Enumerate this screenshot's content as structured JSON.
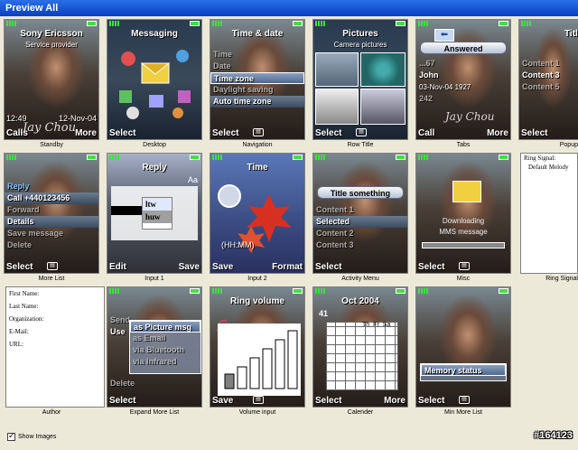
{
  "window": {
    "title": "Preview All"
  },
  "cells": {
    "standby": {
      "label": "Standby",
      "title": "Sony Ericsson",
      "subtitle": "Service provider",
      "time": "12:49",
      "date": "12-Nov-04",
      "artist": "Jay Chou",
      "left": "Calls",
      "right": "More"
    },
    "desktop": {
      "label": "Desktop",
      "title": "Messaging",
      "left": "Select"
    },
    "navigation": {
      "label": "Navigation",
      "title": "Time & date",
      "items": [
        "Time",
        "Date",
        "Time zone",
        "Daylight saving",
        "Auto time zone"
      ],
      "left": "Select"
    },
    "rowtitle": {
      "label": "Row Title",
      "title": "Pictures",
      "subtitle": "Camera pictures",
      "left": "Select"
    },
    "tabs": {
      "label": "Tabs",
      "tab": "Answered",
      "rows": [
        "...67",
        "John",
        "03-Nov-04 1927",
        "242"
      ],
      "artist": "Jay Chou",
      "left": "Call",
      "right": "More"
    },
    "popup": {
      "label": "Popup",
      "title": "Title",
      "items": [
        "Content 1",
        "Content 3",
        "Content 5"
      ],
      "left": "Select"
    },
    "morelist": {
      "label": "More List",
      "items": [
        "Reply",
        "Call +440123456",
        "Forward",
        "Details",
        "Save message",
        "Delete"
      ],
      "left": "Select"
    },
    "input1": {
      "label": "Input 1",
      "title": "Reply",
      "text": "Aa",
      "candidates": [
        "ltw",
        "huw"
      ],
      "left": "Edit",
      "right": "Save"
    },
    "input2": {
      "label": "Input 2",
      "title": "Time",
      "clock": "(HH:MM)",
      "left": "Save",
      "right": "Format"
    },
    "activitymenu": {
      "label": "Activity Menu",
      "title": "Title something",
      "items": [
        "Content 1",
        "Selected",
        "Content 2",
        "Content 3"
      ],
      "left": "Select"
    },
    "misc": {
      "label": "Misc",
      "line1": "Downloading",
      "line2": "MMS message",
      "left": "Select"
    },
    "ringsignal": {
      "label": "Ring Signal",
      "text1": "Ring Signal:",
      "text2": "Default Melody"
    },
    "author": {
      "label": "Author",
      "fields": [
        "First Name:",
        "Last Name:",
        "Organization:",
        "E-Mail:",
        "URL:"
      ]
    },
    "expandmore": {
      "label": "Expand More List",
      "items": [
        "Send",
        "Use",
        "as Picture msg",
        "as Email",
        "via Bluetooth",
        "via Infrared",
        "Delete"
      ],
      "left": "Select"
    },
    "volume": {
      "label": "Volume input",
      "title": "Ring volume",
      "left": "Save"
    },
    "calendar": {
      "label": "Calender",
      "title": "Oct 2004",
      "week": "41",
      "days": [
        "Th",
        "Fr",
        "Sa"
      ],
      "left": "Select",
      "right": "More"
    },
    "minimore": {
      "label": "Min More List",
      "item": "Memory status",
      "left": "Select"
    }
  },
  "footer": {
    "show_images": "Show Images",
    "watermark": "#164123"
  }
}
